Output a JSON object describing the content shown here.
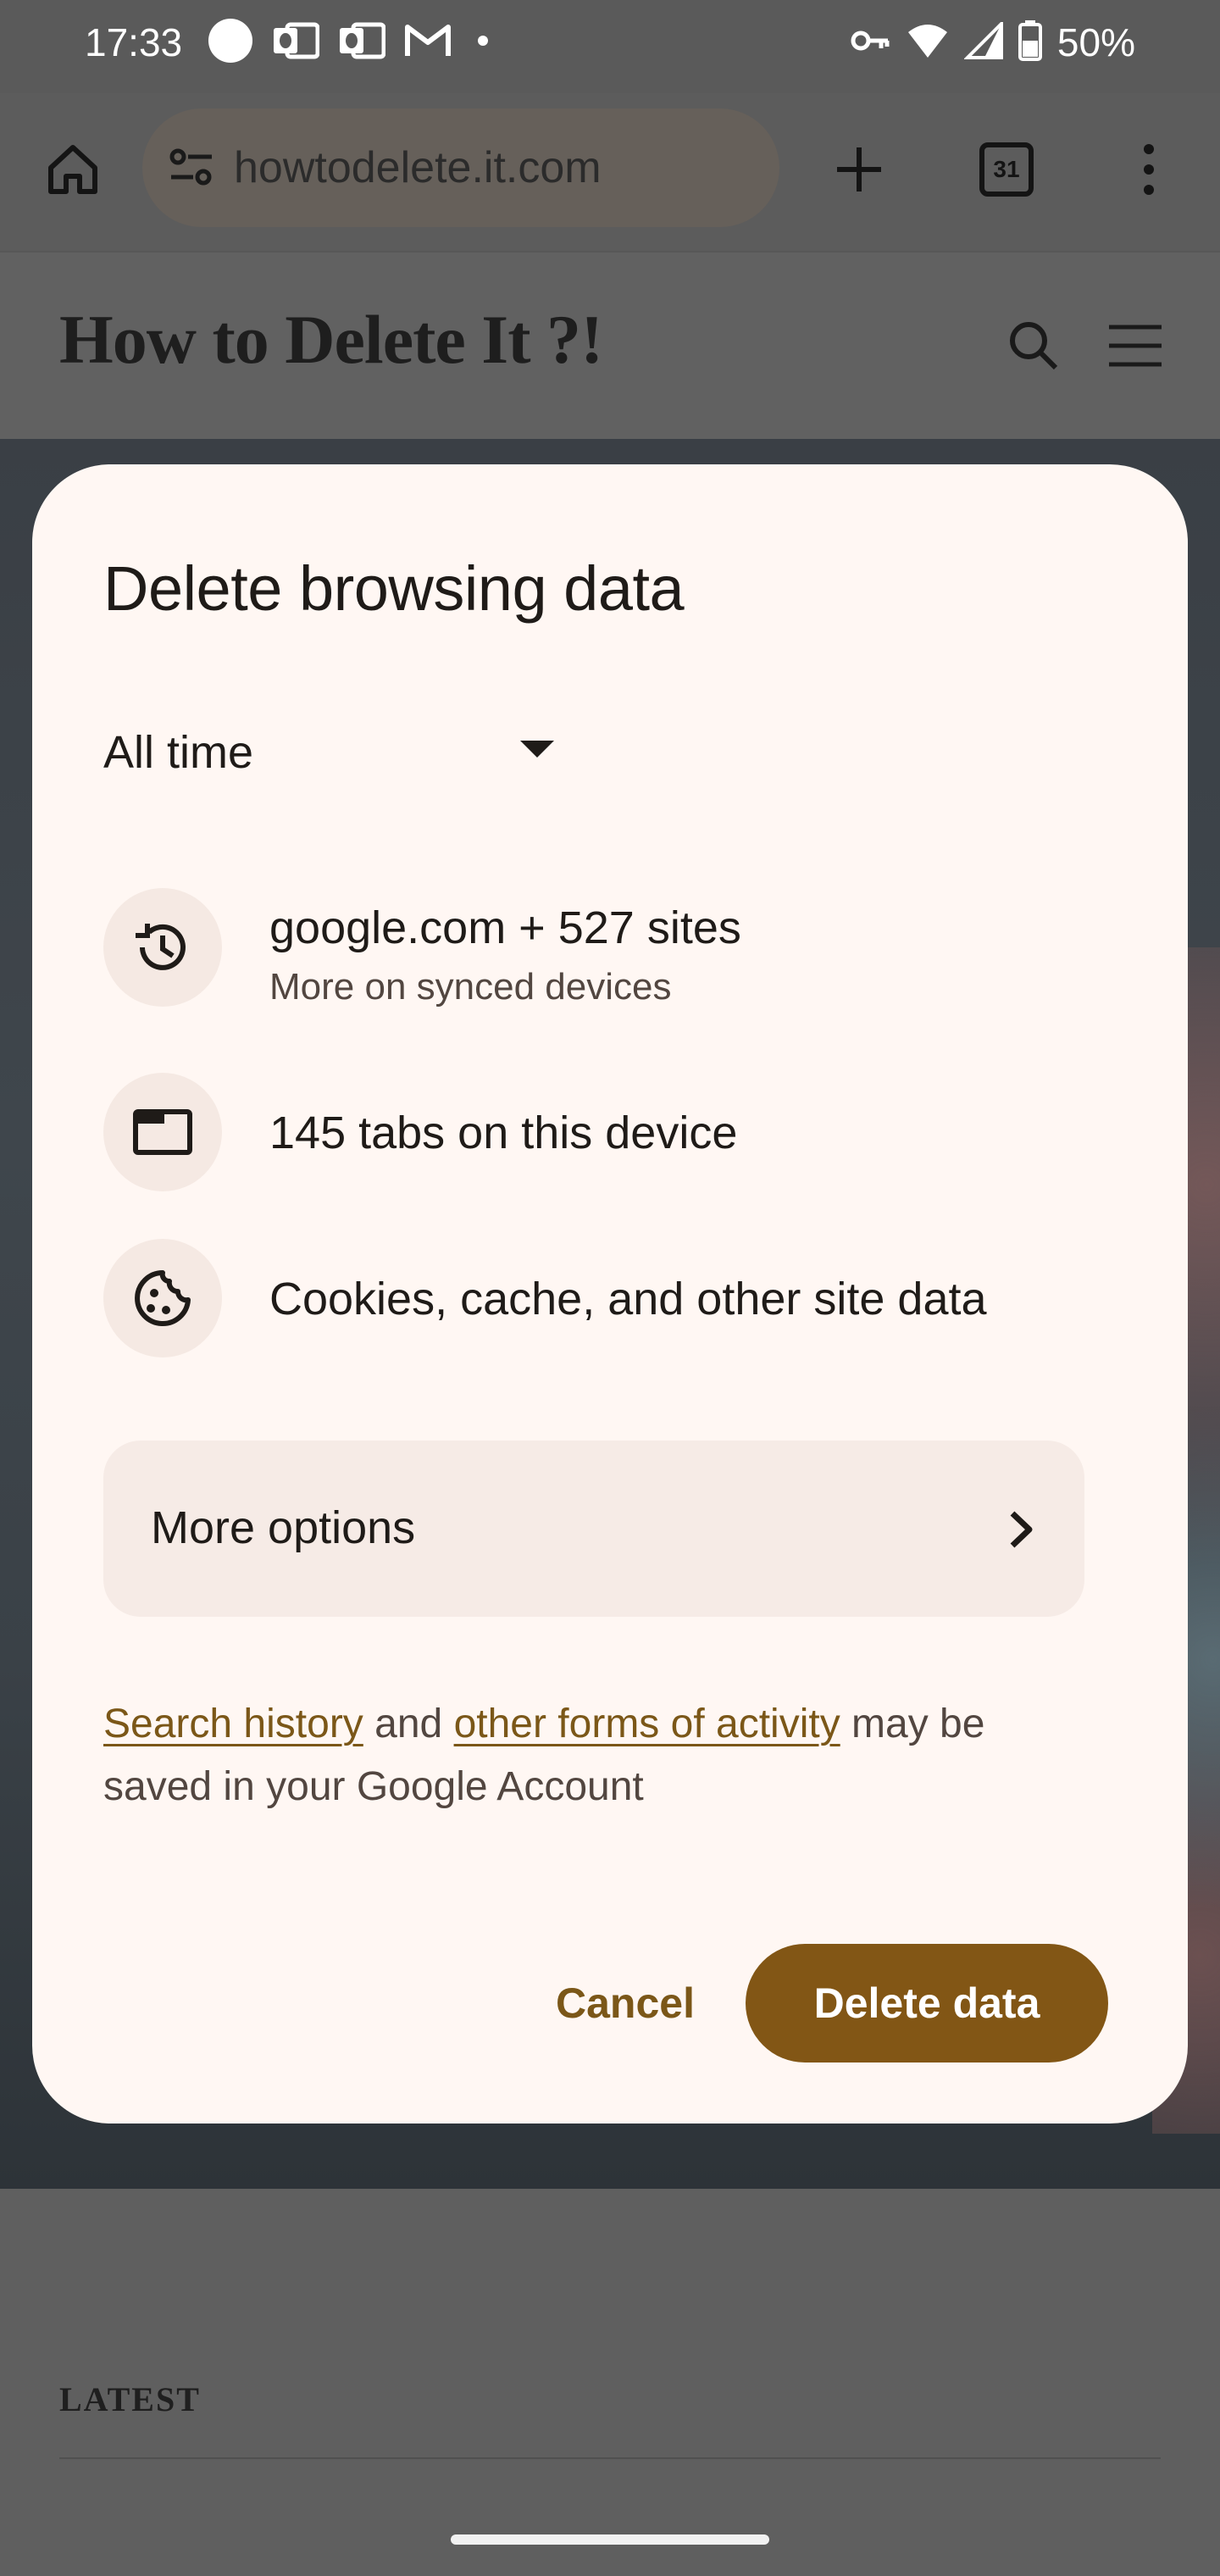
{
  "status_bar": {
    "time": "17:33",
    "icons": [
      "circle-notification-icon",
      "outlook-icon",
      "outlook-icon",
      "gmail-icon",
      "more-notifications-dot-icon"
    ],
    "right_icons": [
      "vpn-key-icon",
      "wifi-icon",
      "cellular-signal-icon",
      "battery-icon"
    ],
    "battery_percent": "50%"
  },
  "toolbar": {
    "url": "howtodelete.it.com",
    "tab_count": "31"
  },
  "site": {
    "title": "How to Delete It ?!"
  },
  "dialog": {
    "title": "Delete browsing data",
    "time_range": "All time",
    "items": [
      {
        "icon": "history-icon",
        "title": "google.com + 527 sites",
        "subtitle": "More on synced devices"
      },
      {
        "icon": "tab-icon",
        "title": "145 tabs on this device"
      },
      {
        "icon": "cookie-icon",
        "title": "Cookies, cache, and other site data"
      }
    ],
    "more_options_label": "More options",
    "notice": {
      "link1": "Search history",
      "text1": " and ",
      "link2": "other forms of activity",
      "text2": " may be saved in your Google Account"
    },
    "cancel_label": "Cancel",
    "delete_label": "Delete data"
  },
  "latest": {
    "label": "LATEST"
  },
  "colors": {
    "accent": "#825615",
    "link": "#7b5718",
    "dialog_bg": "#fff7f3",
    "icon_bg": "#f5e9e3"
  }
}
